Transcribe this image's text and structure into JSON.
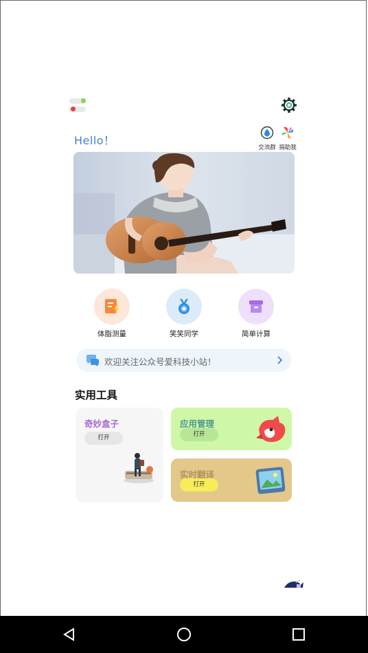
{
  "header": {
    "greeting": "Hello！"
  },
  "top_icons": [
    {
      "label": "交流群",
      "icon": "drop-icon"
    },
    {
      "label": "捐助我",
      "icon": "pinwheel-icon"
    }
  ],
  "quick_actions": [
    {
      "label": "体脂测量",
      "icon": "note-lightning-icon",
      "color": "#f8893a"
    },
    {
      "label": "笑笑同学",
      "icon": "medal-icon",
      "color": "#2f8fe0"
    },
    {
      "label": "简单计算",
      "icon": "box-icon",
      "color": "#a46ae8"
    }
  ],
  "notice": {
    "text": "欢迎关注公众号爱科技小站！"
  },
  "tools_section": {
    "title": "实用工具",
    "cards": [
      {
        "title": "奇妙盒子",
        "button": "打开",
        "bg": "#f6f6f6",
        "title_color": "#a76dd5"
      },
      {
        "title": "应用管理",
        "button": "打开",
        "bg": "#cff7a8",
        "title_color": "#4f9a8f"
      },
      {
        "title": "实时翻译",
        "button": "打开",
        "bg": "#e3c88a",
        "title_color": "#b2955a"
      }
    ]
  },
  "colors": {
    "accent": "#3f82d8",
    "background": "#ffffff",
    "nav_bar": "#000000"
  }
}
